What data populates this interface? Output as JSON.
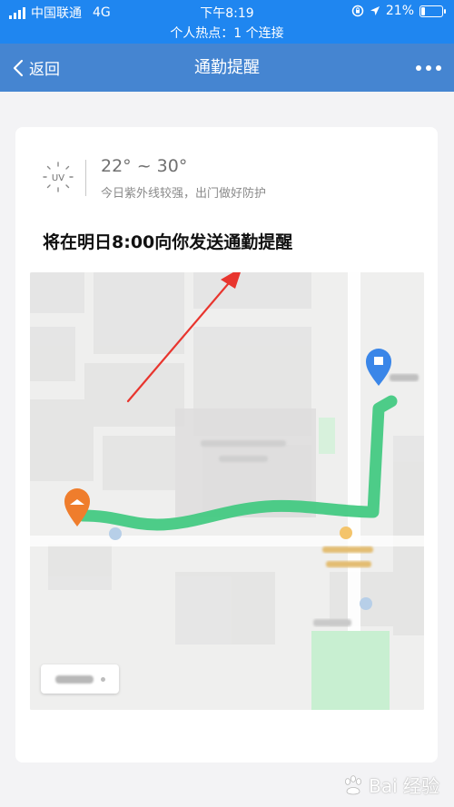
{
  "status_bar": {
    "carrier": "中国联通",
    "network": "4G",
    "time": "下午8:19",
    "battery": "21%",
    "battery_level": 0.21,
    "hotspot": "个人热点：1 个连接"
  },
  "nav": {
    "back_label": "返回",
    "title": "通勤提醒"
  },
  "weather": {
    "uv_label": "UV",
    "temperature": "22° ~ 30°",
    "tip": "今日紫外线较强，出门做好防护"
  },
  "reminder": {
    "text": "将在明日8:00向你发送通勤提醒"
  },
  "map": {
    "route_color": "#3fc97f",
    "origin_color": "#ef7d2c",
    "destination_color": "#3a86e8",
    "annotation_color": "#e8352e"
  },
  "watermark": {
    "text": "Bai 经验"
  },
  "colors": {
    "status_bar": "#1f86f0",
    "nav_bar": "#4585d1"
  }
}
